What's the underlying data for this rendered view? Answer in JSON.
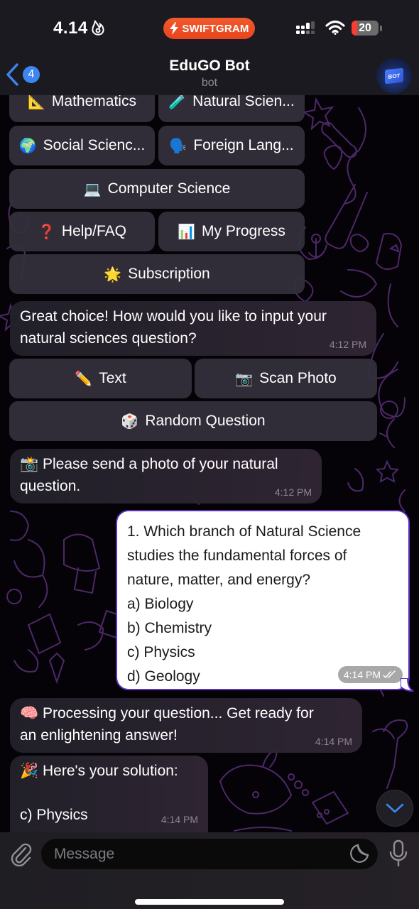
{
  "status_bar": {
    "time": "4.14",
    "focus_icon": "flame-icon",
    "app_badge": "SWIFTGRAM",
    "battery_percent": 20,
    "battery_label": "20",
    "signal_icon": "cellular-signal-icon",
    "wifi_icon": "wifi-icon"
  },
  "header": {
    "back_badge_count": "4",
    "title": "EduGO Bot",
    "subtitle": "bot",
    "avatar_label": "BOT"
  },
  "keyboard_main": [
    {
      "emoji": "📐",
      "label": "Mathematics"
    },
    {
      "emoji": "🧪",
      "label": "Natural Scien..."
    },
    {
      "emoji": "🌍",
      "label": "Social Scienc..."
    },
    {
      "emoji": "🗣️",
      "label": "Foreign Lang..."
    },
    {
      "emoji": "💻",
      "label": "Computer Science"
    },
    {
      "emoji": "❓",
      "label": "Help/FAQ"
    },
    {
      "emoji": "📊",
      "label": "My Progress"
    },
    {
      "emoji": "🌟",
      "label": "Subscription"
    }
  ],
  "messages": [
    {
      "direction": "in",
      "text_lines": [
        "Great choice! How would you like to input your",
        "natural sciences question?"
      ],
      "time": "4:12 PM"
    },
    {
      "direction": "in",
      "emoji": "📸",
      "text_lines": [
        "Please send a photo of your natural",
        "question."
      ],
      "time": "4:12 PM"
    },
    {
      "direction": "out",
      "text_lines": [
        "1. Which branch of Natural Science",
        "studies the fundamental forces of",
        "nature, matter, and energy?",
        "a) Biology",
        "b) Chemistry",
        "c) Physics",
        "d) Geology"
      ],
      "time": "4:14 PM",
      "read_status": "double-check-icon"
    },
    {
      "direction": "in",
      "emoji": "🧠",
      "text_lines": [
        "Processing your question... Get ready for",
        "an enlightening answer!"
      ],
      "time": "4:14 PM"
    },
    {
      "direction": "in",
      "emoji": "🎉",
      "text_lines": [
        "Here's your solution:",
        "",
        "c) Physics"
      ],
      "time": "4:14 PM"
    }
  ],
  "keyboard_input_mode": [
    {
      "emoji": "✏️",
      "label": "Text"
    },
    {
      "emoji": "📷",
      "label": "Scan Photo"
    },
    {
      "emoji": "🎲",
      "label": "Random Question"
    }
  ],
  "composer": {
    "placeholder": "Message",
    "value": ""
  },
  "colors": {
    "accent": "#3d86f0",
    "swiftgram": "#ee4f24",
    "outgoing_border": "#5b2fbf",
    "wallpaper_doodle": "#6a3a8c"
  }
}
